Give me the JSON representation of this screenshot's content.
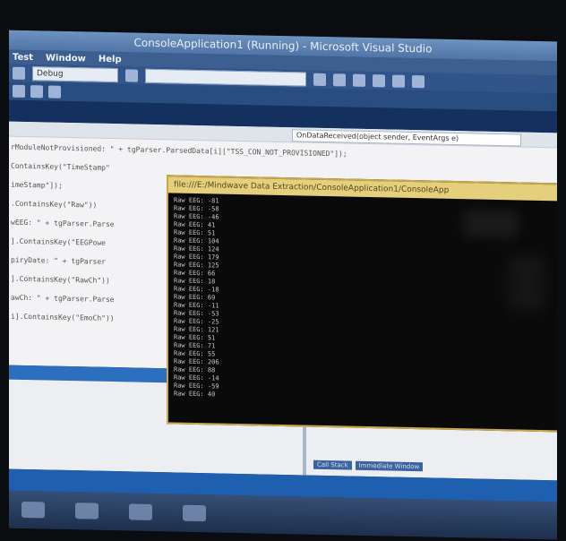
{
  "window": {
    "title": "ConsoleApplication1 (Running) - Microsoft Visual Studio"
  },
  "menu": {
    "items": [
      "Test",
      "Window",
      "Help"
    ]
  },
  "toolbar": {
    "config_value": "Debug"
  },
  "editor": {
    "nav_combo": "OnDataReceived(object sender, EventArgs e)",
    "code_lines": [
      "rModuleNotProvisioned: \" + tgParser.ParsedData[i][\"TSS_CON_NOT_PROVISIONED\"]);",
      "",
      "ContainsKey(\"TimeStamp\"",
      "",
      "imeStamp\"]);",
      "",
      ".ContainsKey(\"Raw\"))",
      "",
      "wEEG: \" + tgParser.Parse",
      "",
      "].ContainsKey(\"EEGPowe",
      "piryDate: \" + tgParser",
      "",
      "].ContainsKey(\"RawCh\"))",
      "",
      "awCh: \" + tgParser.Parse",
      "",
      "i].ContainsKey(\"EmoCh\"))"
    ]
  },
  "console": {
    "title": "file:///E:/Mindwave Data Extraction/ConsoleApplication1/ConsoleApp",
    "lines": [
      "Raw EEG: -81",
      "Raw EEG: -58",
      "Raw EEG: -46",
      "Raw EEG: 41",
      "Raw EEG: 51",
      "Raw EEG: 104",
      "Raw EEG: 124",
      "Raw EEG: 179",
      "Raw EEG: 125",
      "Raw EEG: 66",
      "Raw EEG: 18",
      "Raw EEG: -18",
      "Raw EEG: 69",
      "Raw EEG: -11",
      "Raw EEG: -53",
      "Raw EEG: -25",
      "Raw EEG: 121",
      "Raw EEG: 51",
      "Raw EEG: 71",
      "Raw EEG: 55",
      "Raw EEG: 206",
      "Raw EEG: 88",
      "Raw EEG: -14",
      "Raw EEG: -59",
      "Raw EEG: 40"
    ]
  },
  "output_tabs": [
    "Call Stack",
    "Immediate Window"
  ]
}
